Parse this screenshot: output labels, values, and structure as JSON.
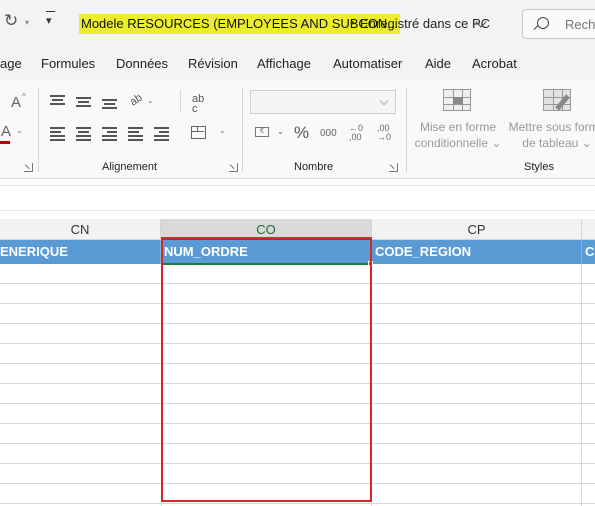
{
  "title_bar": {
    "redo_icon": "redo-icon",
    "customize_icon": "customize-quick-access-icon",
    "document_title": "Modele RESOURCES (EMPLOYEES AND SUBCON...",
    "separator": "•",
    "save_status": "Enregistré dans ce PC",
    "search_placeholder": "Reche",
    "highlight_color": "#ecee2c"
  },
  "tabs": [
    "age",
    "Formules",
    "Données",
    "Révision",
    "Affichage",
    "Automatiser",
    "Aide",
    "Acrobat"
  ],
  "ribbon": {
    "font_group": {
      "grow_icon_text": "A",
      "grow_caret": "^",
      "color_icon_text": "A",
      "drop": "⌄"
    },
    "alignment": {
      "label": "Alignement",
      "orientation_icon_text": "ab",
      "wrap_icon_text": "ab\nc"
    },
    "number": {
      "label": "Nombre",
      "format_value": "",
      "currency_icon_text": "€",
      "percent": "%",
      "comma": "000",
      "increase_decimal": "←0\n,00",
      "decrease_decimal": ",00\n→0"
    },
    "styles": {
      "label": "Styles",
      "conditional_format_line1": "Mise en forme",
      "conditional_format_line2": "conditionnelle ⌄",
      "format_table_line1": "Mettre sous forme",
      "format_table_line2": "de tableau ⌄"
    }
  },
  "grid": {
    "column_letters": [
      "CN",
      "CO",
      "CP"
    ],
    "selected_column": "CO",
    "header_cells": [
      "ENERIQUE",
      "NUM_ORDRE",
      "CODE_REGION",
      "CO"
    ],
    "header_color": "#5b9bd5",
    "selection_color": "#1f7a44",
    "highlight_box_color": "#d72828"
  }
}
